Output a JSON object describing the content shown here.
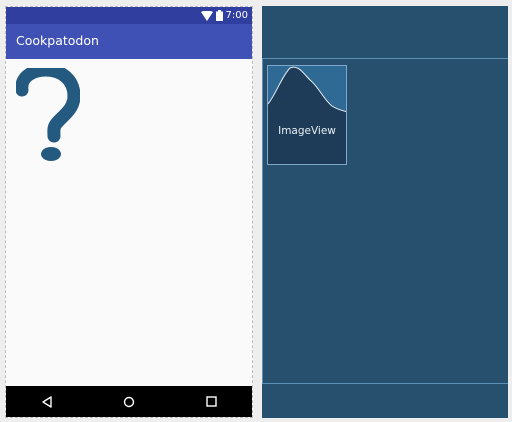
{
  "design": {
    "status_bar": {
      "time": "7:00",
      "icons": [
        "wifi-icon",
        "battery-icon"
      ]
    },
    "app_bar": {
      "title": "Cookpatodon"
    },
    "content": {
      "image_icon": "question-mark-icon"
    },
    "nav_bar": {
      "buttons": [
        "back-icon",
        "home-icon",
        "recents-icon"
      ]
    }
  },
  "blueprint": {
    "imageview": {
      "label": "ImageView"
    }
  },
  "colors": {
    "status_bar": "#303f9f",
    "app_bar": "#3f51b5",
    "blueprint_bg": "#274f6e",
    "question_mark": "#245a80"
  }
}
